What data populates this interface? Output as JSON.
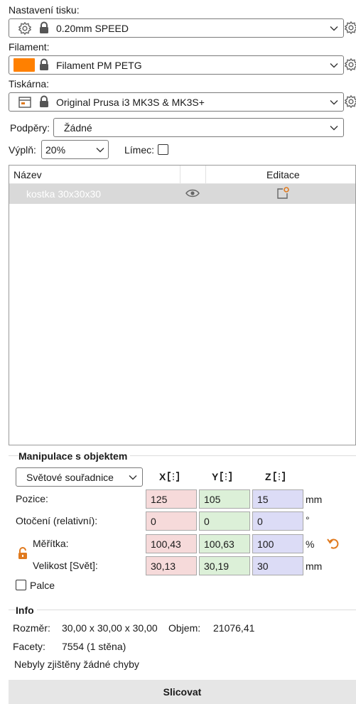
{
  "print_settings": {
    "label": "Nastavení tisku:",
    "value": "0.20mm SPEED"
  },
  "filament": {
    "label": "Filament:",
    "value": "Filament PM PETG",
    "color": "#ff8000"
  },
  "printer": {
    "label": "Tiskárna:",
    "value": "Original Prusa i3 MK3S & MK3S+"
  },
  "supports": {
    "label": "Podpěry:",
    "value": "Žádné"
  },
  "infill": {
    "label": "Výplň:",
    "value": "20%"
  },
  "brim": {
    "label": "Límec:",
    "checked": false
  },
  "object_list": {
    "headers": {
      "name": "Název",
      "editing": "Editace"
    },
    "rows": [
      {
        "name": "kostka 30x30x30"
      }
    ]
  },
  "manipulation": {
    "title": "Manipulace s objektem",
    "coord_system": "Světové souřadnice",
    "axes": {
      "x": "X",
      "y": "Y",
      "z": "Z"
    },
    "position": {
      "label": "Pozice:",
      "x": "125",
      "y": "105",
      "z": "15",
      "unit": "mm"
    },
    "rotation": {
      "label": "Otočení (relativní):",
      "x": "0",
      "y": "0",
      "z": "0",
      "unit": "°"
    },
    "scale": {
      "label": "Měřítka:",
      "x": "100,43",
      "y": "100,63",
      "z": "100",
      "unit": "%"
    },
    "size": {
      "label": "Velikost [Svět]:",
      "x": "30,13",
      "y": "30,19",
      "z": "30",
      "unit": "mm"
    },
    "inches": {
      "label": "Palce",
      "checked": false
    }
  },
  "info": {
    "title": "Info",
    "size_label": "Rozměr:",
    "size_value": "30,00 x 30,00 x 30,00",
    "volume_label": "Objem:",
    "volume_value": "21076,41",
    "facets_label": "Facety:",
    "facets_value": "7554 (1 stěna)",
    "errors_text": "Nebyly zjištěny žádné chyby"
  },
  "slice_button": "Slicovat",
  "accent_color": "#e07a1f"
}
